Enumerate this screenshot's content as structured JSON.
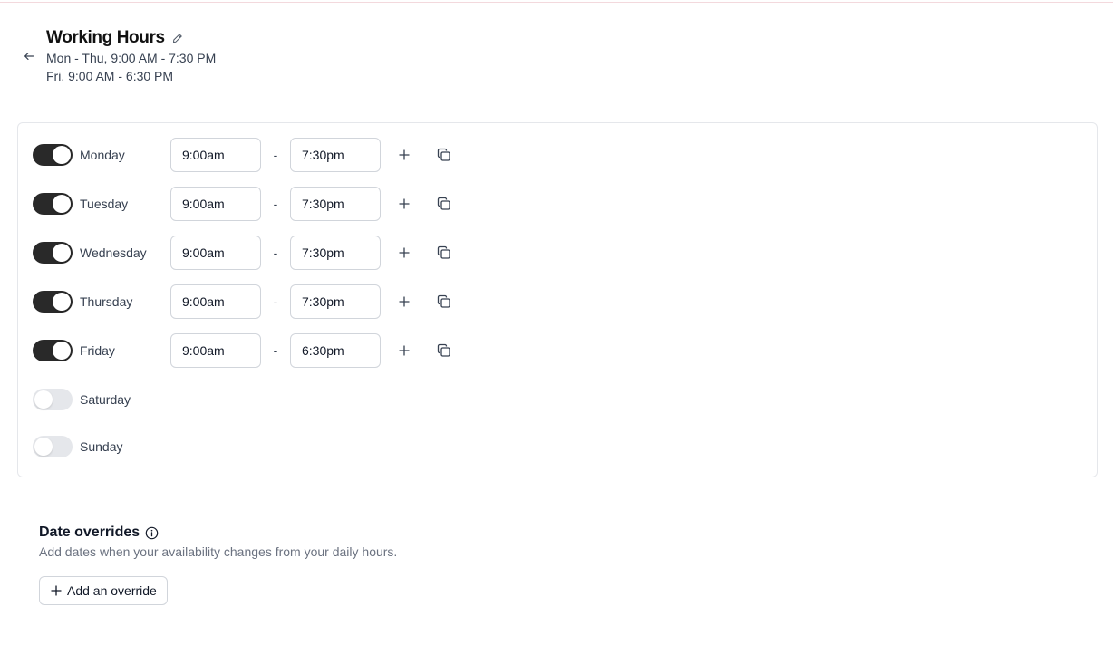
{
  "header": {
    "title": "Working Hours",
    "summary_lines": [
      "Mon - Thu, 9:00 AM - 7:30 PM",
      "Fri, 9:00 AM - 6:30 PM"
    ],
    "back_icon": "arrow-left-icon",
    "edit_icon": "pencil-icon"
  },
  "schedule": {
    "separator": "-",
    "days": [
      {
        "label": "Monday",
        "enabled": true,
        "start": "9:00am",
        "end": "7:30pm"
      },
      {
        "label": "Tuesday",
        "enabled": true,
        "start": "9:00am",
        "end": "7:30pm"
      },
      {
        "label": "Wednesday",
        "enabled": true,
        "start": "9:00am",
        "end": "7:30pm"
      },
      {
        "label": "Thursday",
        "enabled": true,
        "start": "9:00am",
        "end": "7:30pm"
      },
      {
        "label": "Friday",
        "enabled": true,
        "start": "9:00am",
        "end": "6:30pm"
      },
      {
        "label": "Saturday",
        "enabled": false
      },
      {
        "label": "Sunday",
        "enabled": false
      }
    ],
    "add_icon": "plus-icon",
    "copy_icon": "copy-icon"
  },
  "overrides": {
    "title": "Date overrides",
    "description": "Add dates when your availability changes from your daily hours.",
    "add_button_label": "Add an override",
    "info_icon": "info-icon"
  },
  "colors": {
    "toggle_on": "#292929",
    "toggle_off": "#e5e7eb",
    "border": "#d1d5db",
    "muted_text": "#6b7280"
  }
}
